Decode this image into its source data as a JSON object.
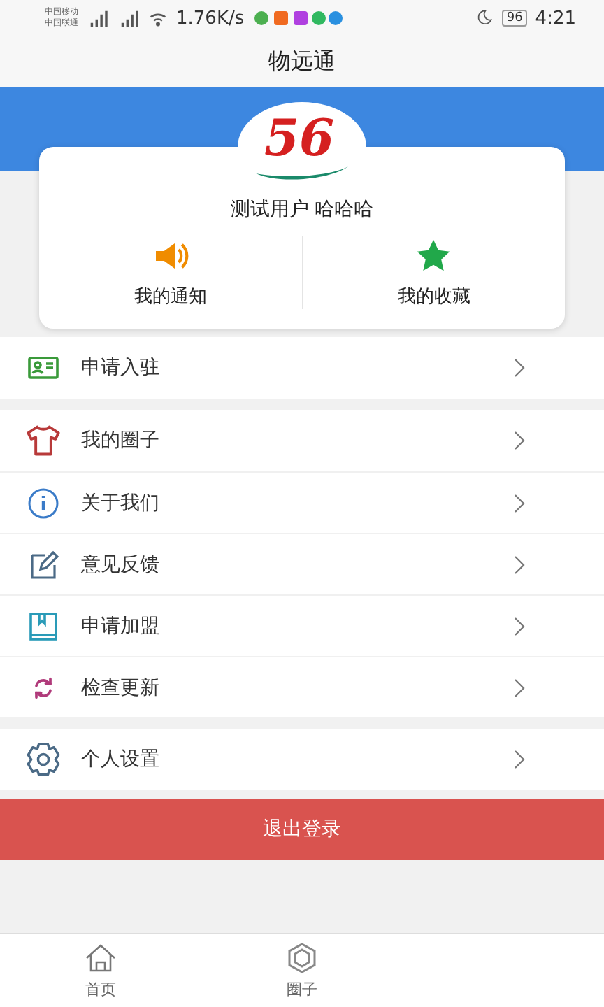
{
  "status_bar": {
    "carrier_1": "中国移动",
    "carrier_2": "中国联通",
    "speed": "1.76K/s",
    "battery": "96",
    "time": "4:21"
  },
  "title": "物远通",
  "profile": {
    "logo_text": "56",
    "user_name": "测试用户 哈哈哈",
    "actions": [
      {
        "label": "我的通知"
      },
      {
        "label": "我的收藏"
      }
    ]
  },
  "menu_groups": [
    [
      {
        "label": "申请入驻"
      }
    ],
    [
      {
        "label": "我的圈子"
      },
      {
        "label": "关于我们"
      },
      {
        "label": "意见反馈"
      },
      {
        "label": "申请加盟"
      },
      {
        "label": "检查更新"
      }
    ],
    [
      {
        "label": "个人设置"
      }
    ]
  ],
  "logout_button": "退出登录",
  "tab_bar": [
    {
      "label": "首页",
      "selected": false
    },
    {
      "label": "圈子",
      "selected": false
    }
  ]
}
